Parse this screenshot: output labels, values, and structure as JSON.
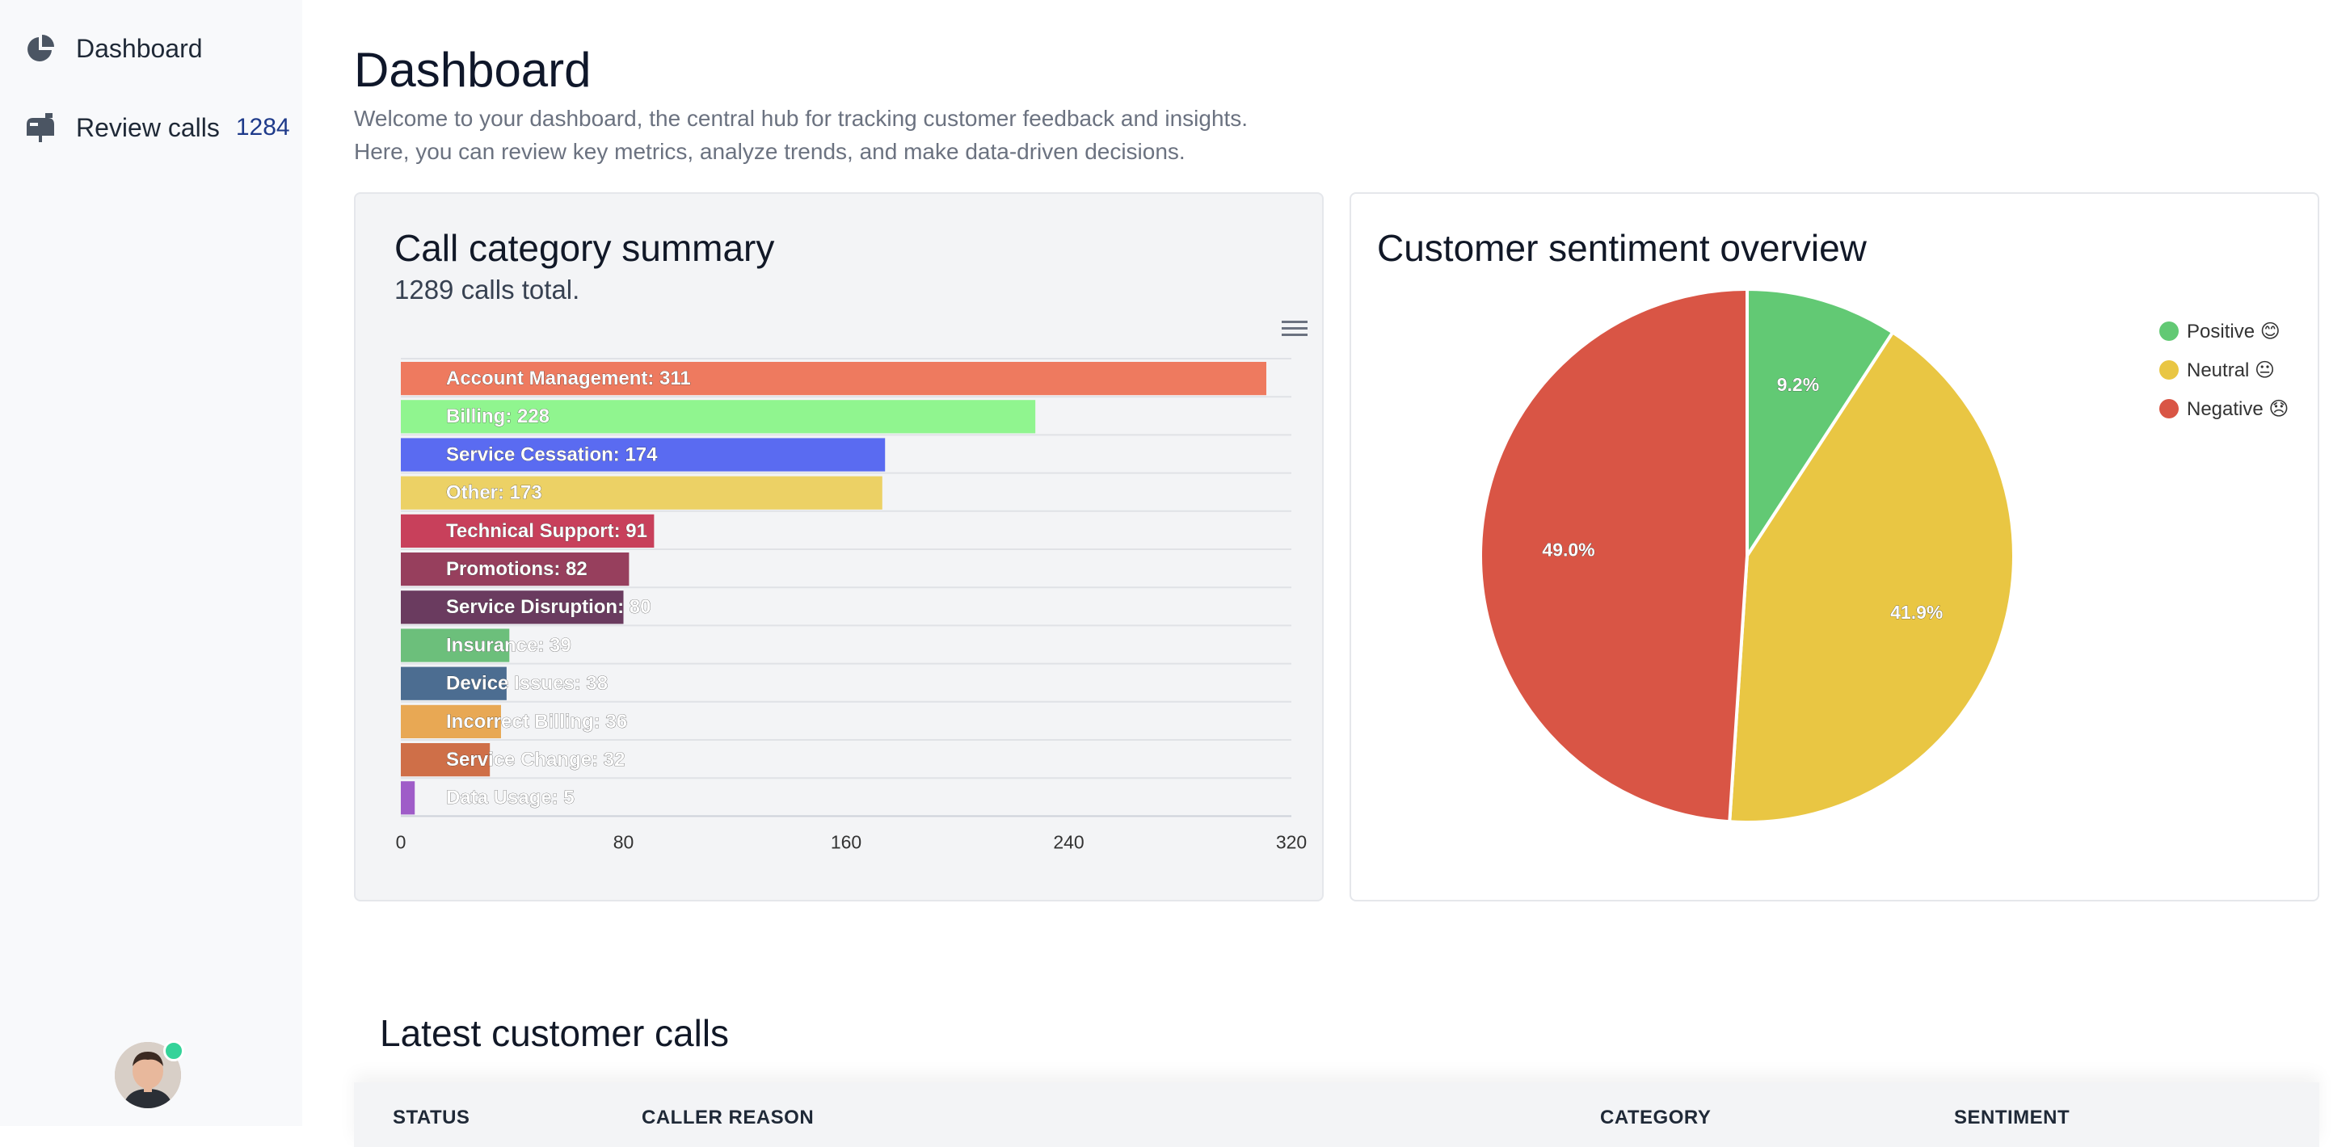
{
  "sidebar": {
    "items": [
      {
        "label": "Dashboard",
        "icon": "pie-chart-icon"
      },
      {
        "label": "Review calls",
        "icon": "mailbox-icon",
        "count": "1284"
      }
    ],
    "avatar": {
      "status": "online"
    }
  },
  "header": {
    "title": "Dashboard",
    "description_line1": "Welcome to your dashboard, the central hub for tracking customer feedback and insights.",
    "description_line2": "Here, you can review key metrics, analyze trends, and make data-driven decisions."
  },
  "category_card": {
    "title": "Call category summary",
    "subtitle": "1289 calls total."
  },
  "sentiment_card": {
    "title": "Customer sentiment overview"
  },
  "latest_calls": {
    "title": "Latest customer calls",
    "columns": [
      "STATUS",
      "CALLER REASON",
      "CATEGORY",
      "SENTIMENT"
    ]
  },
  "chart_data": [
    {
      "type": "bar",
      "orientation": "horizontal",
      "categories": [
        "Account Management",
        "Billing",
        "Service Cessation",
        "Other",
        "Technical Support",
        "Promotions",
        "Service Disruption",
        "Insurance",
        "Device Issues",
        "Incorrect Billing",
        "Service Change",
        "Data Usage"
      ],
      "values": [
        311,
        228,
        174,
        173,
        91,
        82,
        80,
        39,
        38,
        36,
        32,
        5
      ],
      "colors": [
        "#ee7a5f",
        "#90f58f",
        "#5a6bf1",
        "#ecd165",
        "#c8405b",
        "#973f5d",
        "#6a3b5f",
        "#6cbf7b",
        "#4c6d91",
        "#e8a854",
        "#cf6f48",
        "#9f5cc8"
      ],
      "data_labels": [
        "Account Management: 311",
        "Billing: 228",
        "Service Cessation: 174",
        "Other: 173",
        "Technical Support: 91",
        "Promotions: 82",
        "Service Disruption: 80",
        "Insurance: 39",
        "Device Issues: 38",
        "Incorrect Billing: 36",
        "Service Change: 32",
        "Data Usage: 5"
      ],
      "x_ticks": [
        "0",
        "80",
        "160",
        "240",
        "320"
      ],
      "xlim": [
        0,
        320
      ],
      "grid": true,
      "legend": "none"
    },
    {
      "type": "pie",
      "categories": [
        "Positive 😊",
        "Neutral 😐",
        "Negative 😞"
      ],
      "values": [
        9.2,
        41.9,
        49.0
      ],
      "labels": [
        "9.2%",
        "41.9%",
        "49.0%"
      ],
      "colors": [
        "#62c974",
        "#e9c643",
        "#d95545"
      ],
      "legend": "top-right"
    }
  ]
}
